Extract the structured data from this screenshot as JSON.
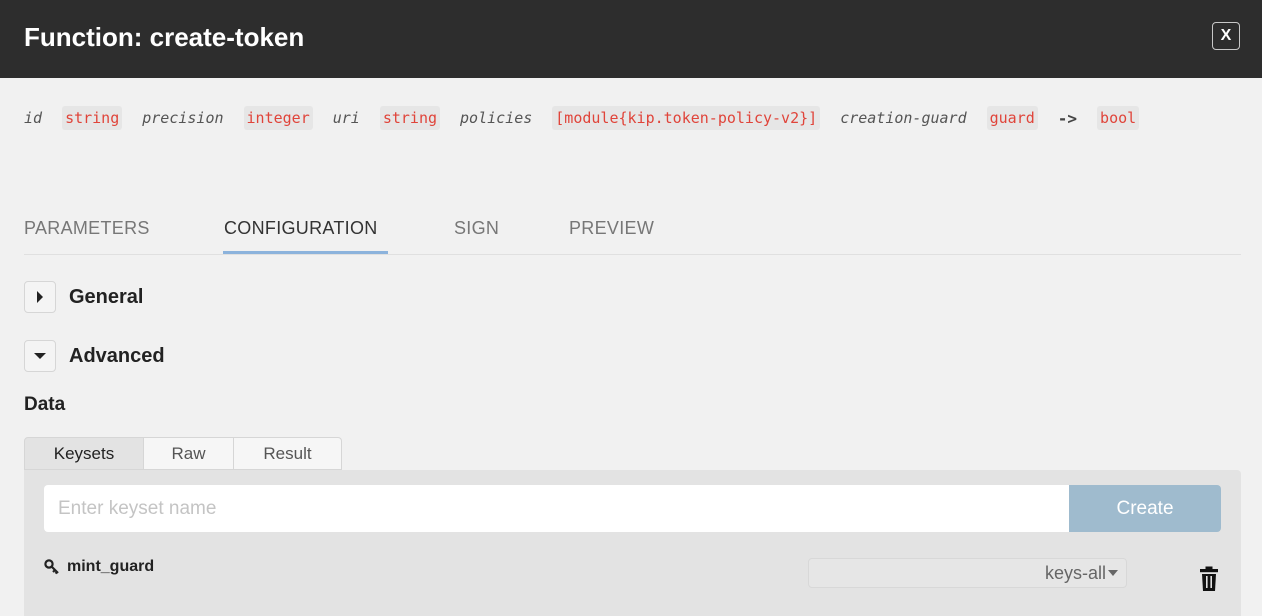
{
  "header": {
    "title": "Function: create-token",
    "close_label": "X"
  },
  "signature": {
    "params": [
      {
        "name": "id",
        "type": "string"
      },
      {
        "name": "precision",
        "type": "integer"
      },
      {
        "name": "uri",
        "type": "string"
      },
      {
        "name": "policies",
        "type": "[module{kip.token-policy-v2}]"
      },
      {
        "name": "creation-guard",
        "type": "guard"
      }
    ],
    "arrow": "->",
    "return_type": "bool"
  },
  "tabs": [
    {
      "label": "PARAMETERS",
      "active": false
    },
    {
      "label": "CONFIGURATION",
      "active": true
    },
    {
      "label": "SIGN",
      "active": false
    },
    {
      "label": "PREVIEW",
      "active": false
    }
  ],
  "sections": {
    "general": {
      "label": "General",
      "expanded": false
    },
    "advanced": {
      "label": "Advanced",
      "expanded": true
    }
  },
  "data": {
    "label": "Data",
    "subtabs": [
      {
        "label": "Keysets",
        "active": true
      },
      {
        "label": "Raw",
        "active": false
      },
      {
        "label": "Result",
        "active": false
      }
    ],
    "keyset_input": {
      "placeholder": "Enter keyset name",
      "value": ""
    },
    "create_label": "Create",
    "keysets": [
      {
        "name": "mint_guard",
        "predicate": "keys-all"
      }
    ]
  },
  "colors": {
    "header_bg": "#2d2d2d",
    "type_red": "#e0443a",
    "accent_blue": "#8cb3dc",
    "create_btn": "#9fbbce"
  }
}
